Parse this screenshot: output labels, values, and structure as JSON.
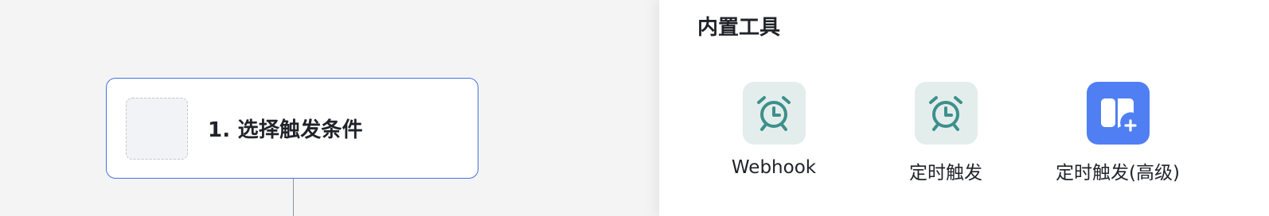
{
  "canvas": {
    "trigger_node": {
      "title": "1. 选择触发条件"
    }
  },
  "panel": {
    "title": "内置工具",
    "tools": [
      {
        "label": "Webhook",
        "icon": "alarm-clock-icon"
      },
      {
        "label": "定时触发",
        "icon": "alarm-clock-icon"
      },
      {
        "label": "定时触发(高级)",
        "icon": "book-plus-icon"
      }
    ]
  },
  "colors": {
    "node_border": "#3f74e6",
    "icon_teal": "#3e8f8c",
    "icon_soft_bg": "#e3eeec",
    "icon_blue_bg": "#4f7ff2"
  }
}
